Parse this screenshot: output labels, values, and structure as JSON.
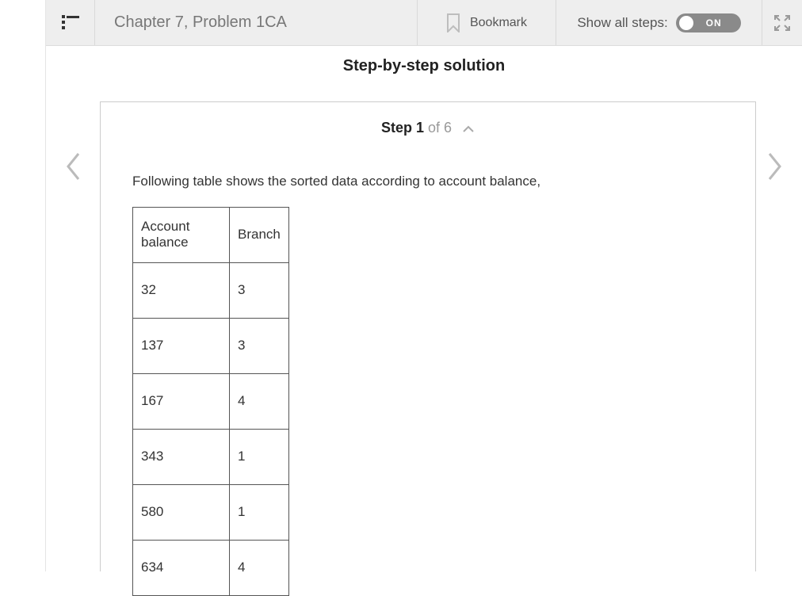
{
  "header": {
    "title": "Chapter 7, Problem 1CA",
    "bookmark_label": "Bookmark",
    "steps_label": "Show all steps:",
    "toggle_state": "ON"
  },
  "solution": {
    "title": "Step-by-step solution",
    "step_label_prefix": "Step 1",
    "step_label_suffix": " of 6",
    "intro": "Following table shows the sorted data according to account balance,",
    "table": {
      "headers": [
        "Account balance",
        "Branch"
      ],
      "rows": [
        [
          "32",
          "3"
        ],
        [
          "137",
          "3"
        ],
        [
          "167",
          "4"
        ],
        [
          "343",
          "1"
        ],
        [
          "580",
          "1"
        ],
        [
          "634",
          "4"
        ]
      ]
    }
  }
}
